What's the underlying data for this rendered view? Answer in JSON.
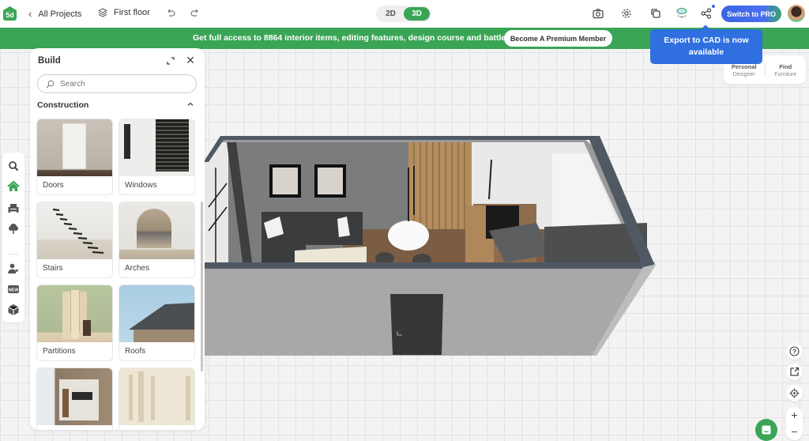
{
  "topbar": {
    "logo_text": "5d",
    "back_label": "All Projects",
    "floor_label": "First floor",
    "modes": [
      {
        "label": "2D",
        "active": false
      },
      {
        "label": "3D",
        "active": true
      }
    ],
    "pro_button": "Switch to PRO",
    "icons": [
      "camera-icon",
      "gear-icon",
      "copy-icon",
      "ai-chat-icon",
      "share-icon"
    ]
  },
  "banner": {
    "text": "Get full access to 8864 interior items, editing features, design course and battles",
    "button": "Become A Premium Member"
  },
  "tooltip": {
    "text": "Export to CAD is now available"
  },
  "designer_panel": {
    "items": [
      {
        "title": "Personal",
        "subtitle": "Designer"
      },
      {
        "title": "Find",
        "subtitle": "Furniture"
      }
    ]
  },
  "left_toolbar": {
    "items": [
      "search-icon",
      "home-icon",
      "armchair-icon",
      "tree-icon",
      "user-heart-icon",
      "new-badge-icon",
      "box-icon"
    ],
    "active": "home-icon"
  },
  "build_panel": {
    "title": "Build",
    "search_placeholder": "Search",
    "section": "Construction",
    "cards": [
      {
        "label": "Doors"
      },
      {
        "label": "Windows"
      },
      {
        "label": "Stairs"
      },
      {
        "label": "Arches"
      },
      {
        "label": "Partitions"
      },
      {
        "label": "Roofs"
      },
      {
        "label": ""
      },
      {
        "label": ""
      }
    ]
  },
  "colors": {
    "brand_green": "#3aa555",
    "accent_blue": "#2f6fe0"
  }
}
